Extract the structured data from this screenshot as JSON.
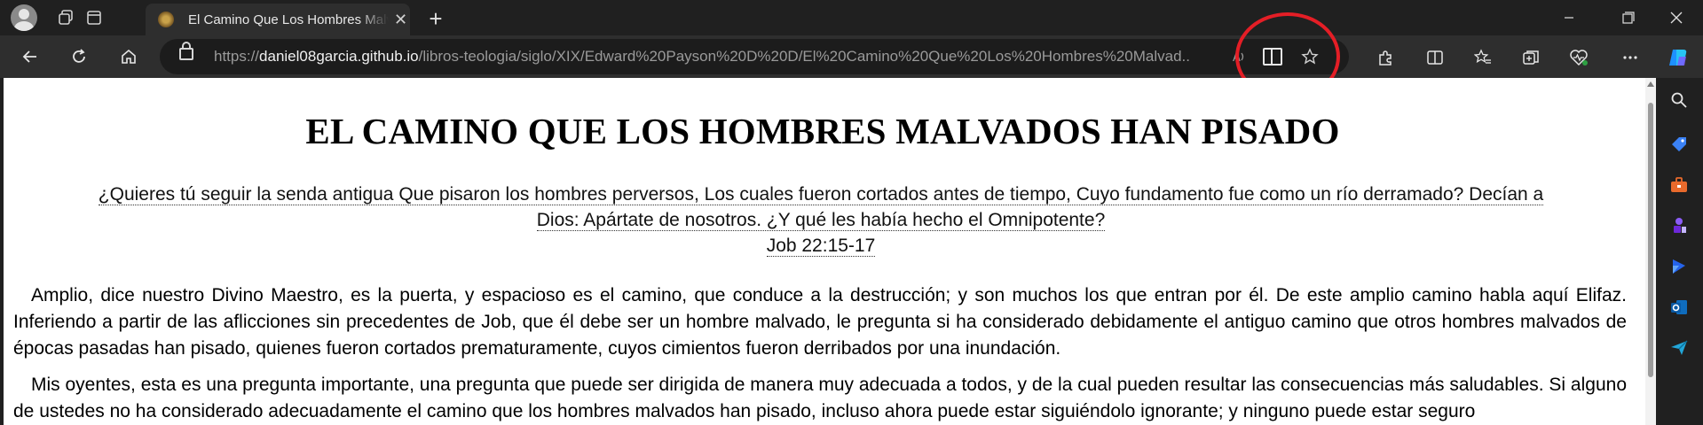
{
  "tab": {
    "title": "El Camino Que Los Hombres Malvados Han Pisado",
    "close": "✕",
    "new": "+"
  },
  "window": {
    "minimize": "—",
    "maximize": "❐",
    "close": "✕"
  },
  "address": {
    "scheme": "https://",
    "host": "daniel08garcia.github.io",
    "path": "/libros-teologia/siglo/XIX/Edward%20Payson%20D%20D/El%20Camino%20Que%20Los%20Hombres%20Malvad..."
  },
  "page": {
    "heading": "EL CAMINO QUE LOS HOMBRES MALVADOS HAN PISADO",
    "epigraph_line1": "¿Quieres tú seguir la senda antigua  Que pisaron los hombres perversos, Los cuales fueron cortados antes de tiempo,  Cuyo fundamento fue como un río derramado? Decían a",
    "epigraph_line2": "Dios: Apártate de nosotros.  ¿Y qué les había hecho el Omnipotente?",
    "epigraph_ref": "Job 22:15-17",
    "paragraph1": "Amplio, dice nuestro Divino Maestro, es la puerta, y espacioso es el camino, que conduce a la destrucción; y son muchos los que entran por él. De este amplio camino habla aquí Elifaz. Inferiendo a partir de las aflicciones sin precedentes de Job, que él debe ser un hombre malvado, le pregunta si ha considerado debidamente el antiguo camino que otros hombres malvados de épocas pasadas han pisado, quienes fueron cortados prematuramente, cuyos cimientos fueron derribados por una inundación.",
    "paragraph2": "Mis oyentes, esta es una pregunta importante, una pregunta que puede ser dirigida de manera muy adecuada a todos, y de la cual pueden resultar las consecuencias más saludables. Si alguno de ustedes no ha considerado adecuadamente el camino que los hombres malvados han pisado, incluso ahora puede estar siguiéndolo ignorante; y ninguno puede estar seguro"
  },
  "colors": {
    "highlight_circle": "#e41e26",
    "chrome_bg": "#202020",
    "toolbar_bg": "#2e2e2e"
  }
}
